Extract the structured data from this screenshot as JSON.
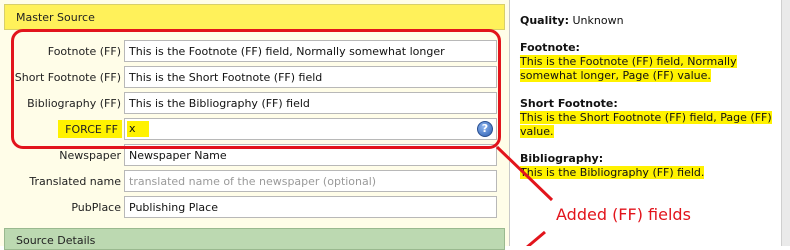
{
  "master": {
    "title": "Master Source",
    "fields": [
      {
        "label": "Footnote (FF)",
        "value": "This is the Footnote (FF) field, Normally somewhat longer"
      },
      {
        "label": "Short Footnote (FF)",
        "value": "This is the Short Footnote (FF) field"
      },
      {
        "label": "Bibliography (FF)",
        "value": "This is the Bibliography (FF) field"
      }
    ],
    "force": {
      "label": "FORCE FF",
      "value": "x",
      "help_icon": "help-icon"
    },
    "newspaper": {
      "label": "Newspaper",
      "value": "Newspaper Name"
    },
    "translated": {
      "label": "Translated name",
      "placeholder": "translated name of the newspaper (optional)"
    },
    "pubplace": {
      "label": "PubPlace",
      "value": "Publishing Place"
    }
  },
  "details": {
    "title": "Source Details"
  },
  "preview": {
    "quality_label": "Quality:",
    "quality_value": "Unknown",
    "footnote_title": "Footnote:",
    "footnote_line1": "This is the Footnote (FF) field, Normally",
    "footnote_line2": "somewhat longer, Page (FF) value.",
    "short_title": "Short Footnote:",
    "short_line1": "This is the Short Footnote (FF) field, Page (FF)",
    "short_line2": "value.",
    "bib_title": "Bibliography:",
    "bib_line1": "This is the Bibliography (FF) field."
  },
  "annotation": {
    "label": "Added (FF) fields"
  },
  "colors": {
    "highlight": "#fff200",
    "annotation_red": "#e2141c",
    "master_header": "#fff15a",
    "details_header": "#bcd9b1"
  }
}
